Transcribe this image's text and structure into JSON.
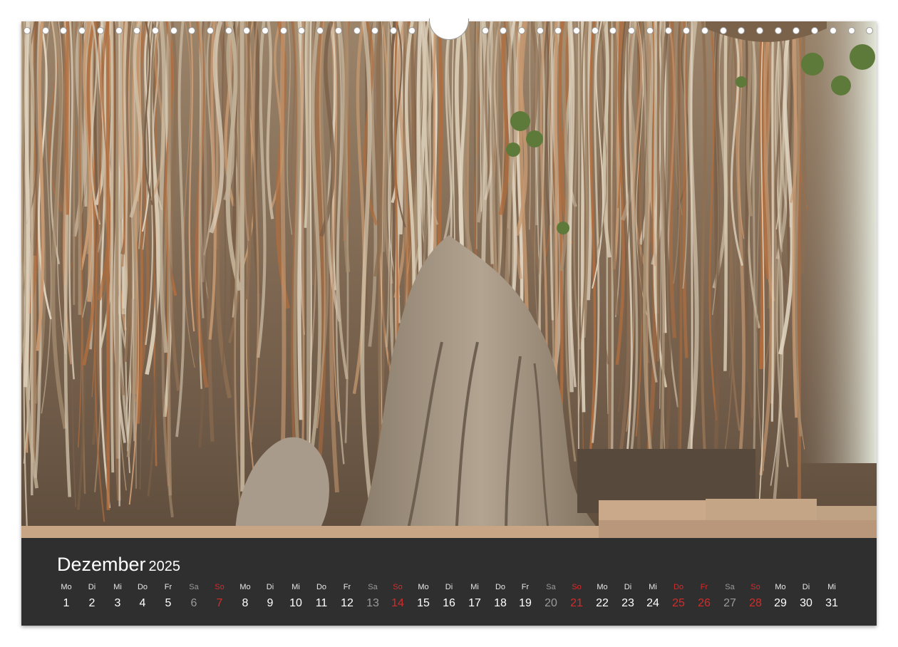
{
  "calendar": {
    "month": "Dezember",
    "year": "2025",
    "colors": {
      "weekday": "#ffffff",
      "saturday": "#9a9a9a",
      "sunday_holiday": "#d62b2b",
      "bar": "#2f2f2f"
    },
    "days": [
      {
        "dow": "Mo",
        "day": "1",
        "type": "weekday"
      },
      {
        "dow": "Di",
        "day": "2",
        "type": "weekday"
      },
      {
        "dow": "Mi",
        "day": "3",
        "type": "weekday"
      },
      {
        "dow": "Do",
        "day": "4",
        "type": "weekday"
      },
      {
        "dow": "Fr",
        "day": "5",
        "type": "weekday"
      },
      {
        "dow": "Sa",
        "day": "6",
        "type": "saturday"
      },
      {
        "dow": "So",
        "day": "7",
        "type": "sunday"
      },
      {
        "dow": "Mo",
        "day": "8",
        "type": "weekday"
      },
      {
        "dow": "Di",
        "day": "9",
        "type": "weekday"
      },
      {
        "dow": "Mi",
        "day": "10",
        "type": "weekday"
      },
      {
        "dow": "Do",
        "day": "11",
        "type": "weekday"
      },
      {
        "dow": "Fr",
        "day": "12",
        "type": "weekday"
      },
      {
        "dow": "Sa",
        "day": "13",
        "type": "saturday"
      },
      {
        "dow": "So",
        "day": "14",
        "type": "sunday"
      },
      {
        "dow": "Mo",
        "day": "15",
        "type": "weekday"
      },
      {
        "dow": "Di",
        "day": "16",
        "type": "weekday"
      },
      {
        "dow": "Mi",
        "day": "17",
        "type": "weekday"
      },
      {
        "dow": "Do",
        "day": "18",
        "type": "weekday"
      },
      {
        "dow": "Fr",
        "day": "19",
        "type": "weekday"
      },
      {
        "dow": "Sa",
        "day": "20",
        "type": "saturday"
      },
      {
        "dow": "So",
        "day": "21",
        "type": "sunday"
      },
      {
        "dow": "Mo",
        "day": "22",
        "type": "weekday"
      },
      {
        "dow": "Di",
        "day": "23",
        "type": "weekday"
      },
      {
        "dow": "Mi",
        "day": "24",
        "type": "weekday"
      },
      {
        "dow": "Do",
        "day": "25",
        "type": "holiday"
      },
      {
        "dow": "Fr",
        "day": "26",
        "type": "holiday"
      },
      {
        "dow": "Sa",
        "day": "27",
        "type": "saturday"
      },
      {
        "dow": "So",
        "day": "28",
        "type": "sunday"
      },
      {
        "dow": "Mo",
        "day": "29",
        "type": "weekday"
      },
      {
        "dow": "Di",
        "day": "30",
        "type": "weekday"
      },
      {
        "dow": "Mi",
        "day": "31",
        "type": "weekday"
      }
    ]
  },
  "photo": {
    "icon": "banyan-tree-roots-photo",
    "colors": {
      "roots_light": "#cdbfa8",
      "roots_dark": "#6d5a44",
      "rust": "#a5653a",
      "trunk": "#a89a88",
      "stone": "#c9a98a",
      "foliage": "#5e7a3a",
      "sky": "#e9efe2"
    }
  }
}
